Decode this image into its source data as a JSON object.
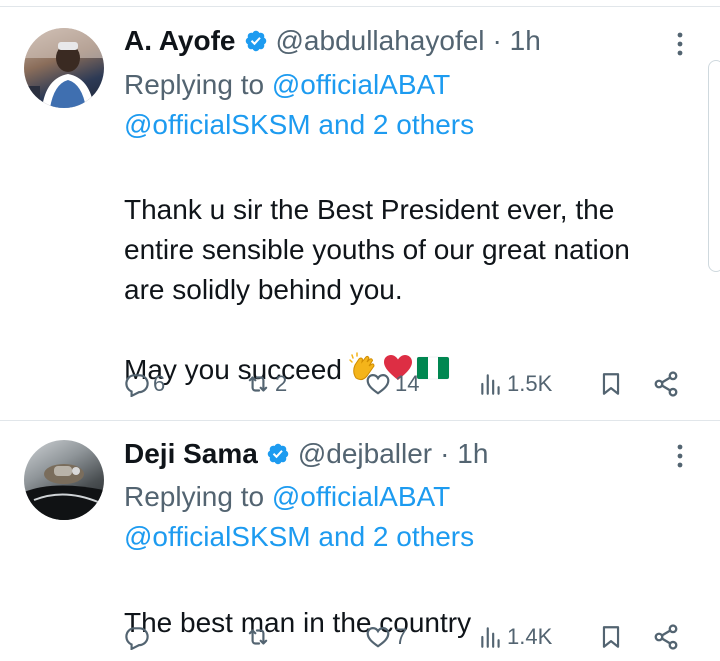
{
  "colors": {
    "link": "#1d9bf0",
    "muted": "#536471",
    "text": "#0f1419",
    "divider": "#e1e6ea"
  },
  "tweets": [
    {
      "name": "A. Ayofe",
      "handle": "@abdullahayofel",
      "time": "· 1h",
      "replying_label": "Replying to ",
      "reply_user_1": "@officialABAT",
      "reply_user_2": "@officialSKSM",
      "and_others": " and 2 others",
      "text": "Thank u sir the Best President ever, the\nentire sensible youths of our great nation\nare solidly behind you.",
      "text_2": " May you succeed",
      "emojis": [
        "clapping-hands-emoji",
        "red-heart-emoji",
        "nigeria-flag-emoji"
      ],
      "replies": "6",
      "reposts": "2",
      "likes": "14",
      "views": "1.5K"
    },
    {
      "name": "Deji Sama",
      "handle": "@dejballer",
      "time": "· 1h",
      "replying_label": "Replying to ",
      "reply_user_1": "@officialABAT",
      "reply_user_2": "@officialSKSM",
      "and_others": " and 2 others",
      "text": "The best man in the country",
      "replies": "",
      "reposts": "",
      "likes": "7",
      "views": "1.4K"
    }
  ],
  "icons": [
    "verified-badge-icon",
    "more-icon",
    "reply-icon",
    "repost-icon",
    "like-icon",
    "views-icon",
    "bookmark-icon",
    "share-icon"
  ]
}
